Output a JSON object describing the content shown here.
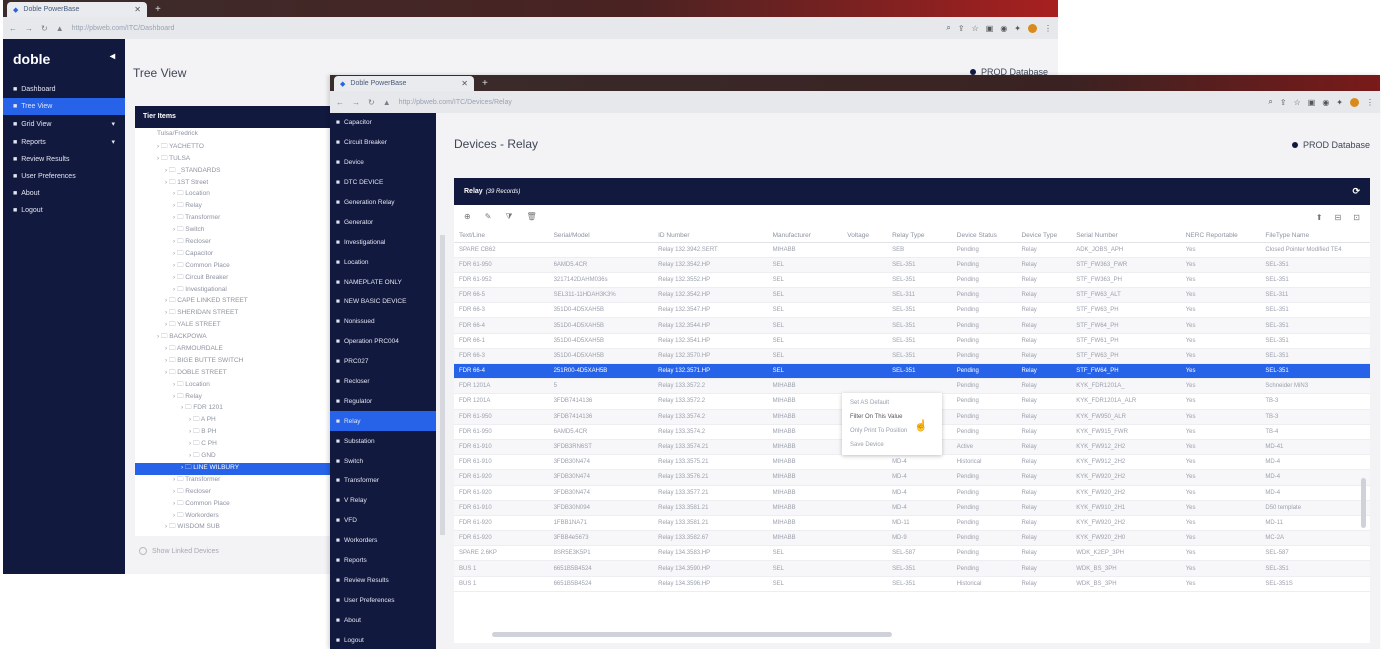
{
  "back": {
    "tab_title": "Doble PowerBase",
    "url": "http://pbweb.com/ITC/Dashboard",
    "logo": "doble",
    "nav": [
      {
        "label": "Dashboard",
        "active": false,
        "caret": ""
      },
      {
        "label": "Tree View",
        "active": true,
        "caret": ""
      },
      {
        "label": "Grid View",
        "active": false,
        "caret": "▾"
      },
      {
        "label": "Reports",
        "active": false,
        "caret": "▾"
      },
      {
        "label": "Review Results",
        "active": false,
        "caret": ""
      },
      {
        "label": "User Preferences",
        "active": false,
        "caret": ""
      },
      {
        "label": "About",
        "active": false,
        "caret": ""
      },
      {
        "label": "Logout",
        "active": false,
        "caret": ""
      }
    ],
    "page_title": "Tree View",
    "prod_label": "PROD Database",
    "tree_header": "Tier Items",
    "tree": [
      {
        "text": "Tulsa/Fredrick",
        "indent": 1,
        "sel": false
      },
      {
        "text": "› 🗀 YACHETTO",
        "indent": 1,
        "sel": false
      },
      {
        "text": "› 🗀 TULSA",
        "indent": 1,
        "sel": false
      },
      {
        "text": "› 🗀 _STANDARDS",
        "indent": 2,
        "sel": false
      },
      {
        "text": "› 🗀 1ST Street",
        "indent": 2,
        "sel": false
      },
      {
        "text": "› 🗀 Location",
        "indent": 3,
        "sel": false
      },
      {
        "text": "› 🗀 Relay",
        "indent": 3,
        "sel": false
      },
      {
        "text": "› 🗀 Transformer",
        "indent": 3,
        "sel": false
      },
      {
        "text": "› 🗀 Switch",
        "indent": 3,
        "sel": false
      },
      {
        "text": "› 🗀 Recloser",
        "indent": 3,
        "sel": false
      },
      {
        "text": "› 🗀 Capacitor",
        "indent": 3,
        "sel": false
      },
      {
        "text": "› 🗀 Common Place",
        "indent": 3,
        "sel": false
      },
      {
        "text": "› 🗀 Circuit Breaker",
        "indent": 3,
        "sel": false
      },
      {
        "text": "› 🗀 Investigational",
        "indent": 3,
        "sel": false
      },
      {
        "text": "› 🗀 CAPE LINKED STREET",
        "indent": 2,
        "sel": false
      },
      {
        "text": "› 🗀 SHERIDAN STREET",
        "indent": 2,
        "sel": false
      },
      {
        "text": "› 🗀 YALE STREET",
        "indent": 2,
        "sel": false
      },
      {
        "text": "› 🗀 BACKPOWA",
        "indent": 1,
        "sel": false
      },
      {
        "text": "› 🗀 ARMOURDALE",
        "indent": 2,
        "sel": false
      },
      {
        "text": "› 🗀 BIGE BUTTE SWITCH",
        "indent": 2,
        "sel": false
      },
      {
        "text": "› 🗀 DOBLE STREET",
        "indent": 2,
        "sel": false
      },
      {
        "text": "› 🗀 Location",
        "indent": 3,
        "sel": false
      },
      {
        "text": "› 🗀 Relay",
        "indent": 3,
        "sel": false
      },
      {
        "text": "› 🗀 FDR 1201",
        "indent": 4,
        "sel": false
      },
      {
        "text": "› 🗀 A PH",
        "indent": 5,
        "sel": false
      },
      {
        "text": "› 🗀 B PH",
        "indent": 5,
        "sel": false
      },
      {
        "text": "› 🗀 C PH",
        "indent": 5,
        "sel": false
      },
      {
        "text": "› 🗀 GND",
        "indent": 5,
        "sel": false
      },
      {
        "text": "› 🗀 LINE WILBURY",
        "indent": 4,
        "sel": true
      },
      {
        "text": "› 🗀 Transformer",
        "indent": 3,
        "sel": false
      },
      {
        "text": "› 🗀 Recloser",
        "indent": 3,
        "sel": false
      },
      {
        "text": "› 🗀 Common Place",
        "indent": 3,
        "sel": false
      },
      {
        "text": "› 🗀 Workorders",
        "indent": 3,
        "sel": false
      },
      {
        "text": "› 🗀 WISDOM SUB",
        "indent": 2,
        "sel": false
      }
    ],
    "footer": "Show Linked Devices"
  },
  "front": {
    "tab_title": "Doble PowerBase",
    "url": "http://pbweb.com/ITC/Devices/Relay",
    "nav": [
      {
        "label": "Capacitor",
        "active": false
      },
      {
        "label": "Circuit Breaker",
        "active": false
      },
      {
        "label": "Device",
        "active": false
      },
      {
        "label": "DTC DEVICE",
        "active": false
      },
      {
        "label": "Generation Relay",
        "active": false
      },
      {
        "label": "Generator",
        "active": false
      },
      {
        "label": "Investigational",
        "active": false
      },
      {
        "label": "Location",
        "active": false
      },
      {
        "label": "NAMEPLATE ONLY",
        "active": false
      },
      {
        "label": "NEW BASIC DEVICE",
        "active": false
      },
      {
        "label": "Nonissued",
        "active": false
      },
      {
        "label": "Operation PRC004",
        "active": false
      },
      {
        "label": "PRC027",
        "active": false
      },
      {
        "label": "Recloser",
        "active": false
      },
      {
        "label": "Regulator",
        "active": false
      },
      {
        "label": "Relay",
        "active": true
      },
      {
        "label": "Substation",
        "active": false
      },
      {
        "label": "Switch",
        "active": false
      },
      {
        "label": "Transformer",
        "active": false
      },
      {
        "label": "V Relay",
        "active": false
      },
      {
        "label": "VFD",
        "active": false
      },
      {
        "label": "Workorders",
        "active": false
      },
      {
        "label": "Reports",
        "active": false
      },
      {
        "label": "Review Results",
        "active": false
      },
      {
        "label": "User Preferences",
        "active": false
      },
      {
        "label": "About",
        "active": false
      },
      {
        "label": "Logout",
        "active": false
      }
    ],
    "page_title": "Devices - Relay",
    "prod_label": "PROD Database",
    "panel_title": "Relay",
    "panel_sub": "(39 Records)",
    "columns": [
      "Text/Line",
      "Serial/Model",
      "ID Number",
      "Manufacturer",
      "Voltage",
      "Relay Type",
      "Device Status",
      "Device Type",
      "Serial Number",
      "NERC Reportable",
      "FileType Name"
    ],
    "rows": [
      [
        "SPARE CB62",
        "",
        "Relay 132.3942.SERT",
        "MIHABB",
        "",
        "SEB",
        "Pending",
        "Relay",
        "ADK_JOBS_APH",
        "Yes",
        "Closed Pointer Modified TE4"
      ],
      [
        "FDR 61-950",
        "6AMD5.4CR",
        "Relay 132.3542.HP",
        "SEL",
        "",
        "SEL-351",
        "Pending",
        "Relay",
        "STF_FW363_FWR",
        "Yes",
        "SEL-351"
      ],
      [
        "FDR 61-952",
        "3217142DAHM036s",
        "Relay 132.3552.HP",
        "SEL",
        "",
        "SEL-351",
        "Pending",
        "Relay",
        "STF_FW363_PH",
        "Yes",
        "SEL-351"
      ],
      [
        "FDR 66-5",
        "SEL311-11HDAH3K3%",
        "Relay 132.3542.HP",
        "SEL",
        "",
        "SEL-311",
        "Pending",
        "Relay",
        "STF_FW63_ALT",
        "Yes",
        "SEL-311"
      ],
      [
        "FDR 66-3",
        "351D0-4D5XAH5B",
        "Relay 132.3547.HP",
        "SEL",
        "",
        "SEL-351",
        "Pending",
        "Relay",
        "STF_FW63_PH",
        "Yes",
        "SEL-351"
      ],
      [
        "FDR 66-4",
        "351D0-4D5XAH5B",
        "Relay 132.3544.HP",
        "SEL",
        "",
        "SEL-351",
        "Pending",
        "Relay",
        "STF_FW64_PH",
        "Yes",
        "SEL-351"
      ],
      [
        "FDR 66-1",
        "351D0-4D5XAH5B",
        "Relay 132.3541.HP",
        "SEL",
        "",
        "SEL-351",
        "Pending",
        "Relay",
        "STF_FW61_PH",
        "Yes",
        "SEL-351"
      ],
      [
        "FDR 66-3",
        "351D0-4D5XAH5B",
        "Relay 132.3570.HP",
        "SEL",
        "",
        "SEL-351",
        "Pending",
        "Relay",
        "STF_FW63_PH",
        "Yes",
        "SEL-351"
      ],
      [
        "FDR 66-4",
        "251R00-4D5XAH5B",
        "Relay 132.3571.HP",
        "SEL",
        "",
        "SEL-351",
        "Pending",
        "Relay",
        "STF_FW64_PH",
        "Yes",
        "SEL-351"
      ],
      [
        "FDR 1201A",
        "5",
        "Relay 133.3572.2",
        "MIHABB",
        "",
        "",
        "Pending",
        "Relay",
        "KYK_FDR1201A_",
        "Yes",
        "Schneider MiN3"
      ],
      [
        "FDR 1201A",
        "3FDB7414136",
        "Relay 133.3572.2",
        "MIHABB",
        "",
        "",
        "Pending",
        "Relay",
        "KYK_FDR1201A_ALR",
        "Yes",
        "TB-3"
      ],
      [
        "FDR 61-950",
        "3FDB7414136",
        "Relay 133.3574.2",
        "MIHABB",
        "",
        "",
        "Pending",
        "Relay",
        "KYK_FW950_ALR",
        "Yes",
        "TB-3"
      ],
      [
        "FDR 61-950",
        "6AMD5.4CR",
        "Relay 133.3574.2",
        "MIHABB",
        "",
        "",
        "Pending",
        "Relay",
        "KYK_FW915_FWR",
        "Yes",
        "TB-4"
      ],
      [
        "FDR 61-910",
        "3FDB3RN6ST",
        "Relay 133.3574.21",
        "MIHABB",
        "",
        "MD-41",
        "Active",
        "Relay",
        "KYK_FW912_2H2",
        "Yes",
        "MD-41"
      ],
      [
        "FDR 61-910",
        "3FDB30N474",
        "Relay 133.3575.21",
        "MIHABB",
        "",
        "MD-4",
        "Historical",
        "Relay",
        "KYK_FW912_2H2",
        "Yes",
        "MD-4"
      ],
      [
        "FDR 61-920",
        "3FDB30N474",
        "Relay 133.3576.21",
        "MIHABB",
        "",
        "MD-4",
        "Pending",
        "Relay",
        "KYK_FW920_2H2",
        "Yes",
        "MD-4"
      ],
      [
        "FDR 61-920",
        "3FDB30N474",
        "Relay 133.3577.21",
        "MIHABB",
        "",
        "MD-4",
        "Pending",
        "Relay",
        "KYK_FW920_2H2",
        "Yes",
        "MD-4"
      ],
      [
        "FDR 61-910",
        "3FDB30N094",
        "Relay 133.3581.21",
        "MIHABB",
        "",
        "MD-4",
        "Pending",
        "Relay",
        "KYK_FW910_2H1",
        "Yes",
        "D50 template"
      ],
      [
        "FDR 61-920",
        "1FBB1NA71",
        "Relay 133.3581.21",
        "MIHABB",
        "",
        "MD-11",
        "Pending",
        "Relay",
        "KYK_FW920_2H2",
        "Yes",
        "MD-11"
      ],
      [
        "FDR 61-920",
        "3FBB4e5673",
        "Relay 133.3582.67",
        "MIHABB",
        "",
        "MD-9",
        "Pending",
        "Relay",
        "KYK_FW920_2H0",
        "Yes",
        "MC-2A"
      ],
      [
        "SPARE 2.6KP",
        "8SR5E3K5P1",
        "Relay 134.3583.HP",
        "SEL",
        "",
        "SEL-587",
        "Pending",
        "Relay",
        "WDK_K2EP_3PH",
        "Yes",
        "SEL-587"
      ],
      [
        "BUS 1",
        "6651B5B4524",
        "Relay 134.3590.HP",
        "SEL",
        "",
        "SEL-351",
        "Pending",
        "Relay",
        "WDK_BS_3PH",
        "Yes",
        "SEL-351"
      ],
      [
        "BUS 1",
        "6651B5B4524",
        "Relay 134.3596.HP",
        "SEL",
        "",
        "SEL-351",
        "Historical",
        "Relay",
        "WDK_BS_3PH",
        "Yes",
        "SEL-351S"
      ]
    ],
    "selected_row": 8,
    "context_menu": [
      "Set AS Default",
      "Filter On This Value",
      "Only Print To Position",
      "Save Device"
    ],
    "toolbar_left": [
      "⊕",
      "✎",
      "⧩",
      "🗑"
    ],
    "toolbar_right": [
      "⬆",
      "⊟",
      "⊡"
    ]
  }
}
